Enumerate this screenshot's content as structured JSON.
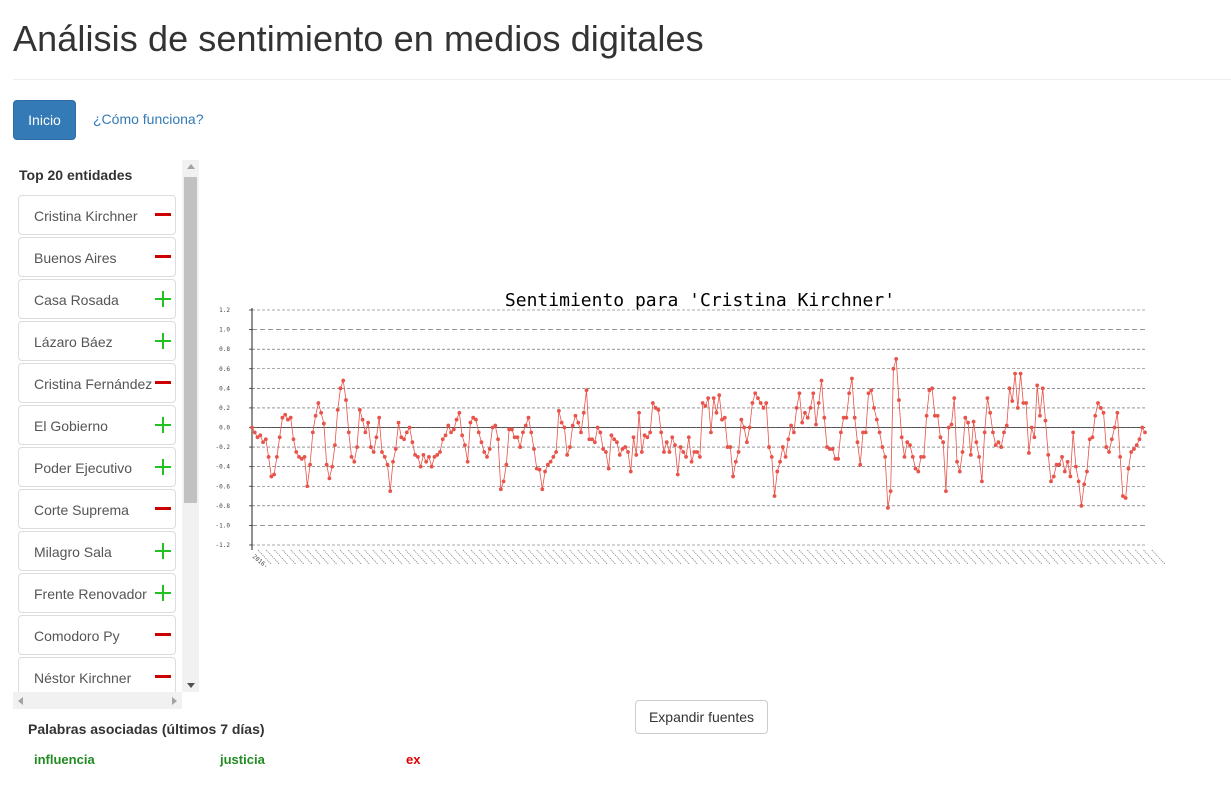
{
  "page": {
    "title": "Análisis de sentimiento en medios digitales"
  },
  "nav": {
    "home_label": "Inicio",
    "how_label": "¿Cómo funciona?"
  },
  "entities_panel": {
    "title": "Top 20 entidades",
    "items": [
      {
        "label": "Cristina Kirchner",
        "sign": "minus"
      },
      {
        "label": "Buenos Aires",
        "sign": "minus"
      },
      {
        "label": "Casa Rosada",
        "sign": "plus"
      },
      {
        "label": "Lázaro Báez",
        "sign": "plus"
      },
      {
        "label": "Cristina Fernández",
        "sign": "minus"
      },
      {
        "label": "El Gobierno",
        "sign": "plus"
      },
      {
        "label": "Poder Ejecutivo",
        "sign": "plus"
      },
      {
        "label": "Corte Suprema",
        "sign": "minus"
      },
      {
        "label": "Milagro Sala",
        "sign": "plus"
      },
      {
        "label": "Frente Renovador",
        "sign": "plus"
      },
      {
        "label": "Comodoro Py",
        "sign": "minus"
      },
      {
        "label": "Néstor Kirchner",
        "sign": "minus"
      }
    ]
  },
  "words": {
    "title": "Palabras asociadas (últimos 7 días)",
    "items": [
      {
        "text": "influencia",
        "color": "#228b22"
      },
      {
        "text": "justicia",
        "color": "#228b22"
      },
      {
        "text": "ex",
        "color": "#dd0000"
      }
    ]
  },
  "expand_button": "Expandir fuentes",
  "colors": {
    "primary": "#337ab7",
    "line": "#e8534a",
    "positive": "#22c222",
    "negative": "#cc0000"
  },
  "chart_data": {
    "type": "line",
    "title": "Sentimiento para 'Cristina Kirchner'",
    "ylim": [
      -1.2,
      1.2
    ],
    "yticks": [
      -1.2,
      -1.0,
      -0.8,
      -0.6,
      -0.4,
      -0.2,
      0.0,
      0.2,
      0.4,
      0.6,
      0.8,
      1.0,
      1.2
    ],
    "ytick_labels": [
      "-1.2",
      "-1.0",
      "-0.8",
      "-0.6",
      "-0.4",
      "-0.2",
      "0.0",
      "0.2",
      "0.4",
      "0.6",
      "0.8",
      "1.0",
      "1.2"
    ],
    "grid": true,
    "first_x_label": "2016-",
    "values": [
      0.0,
      -0.05,
      -0.1,
      -0.08,
      -0.15,
      -0.12,
      -0.3,
      -0.5,
      -0.48,
      -0.3,
      -0.1,
      0.1,
      0.13,
      0.08,
      0.1,
      -0.12,
      -0.25,
      -0.3,
      -0.32,
      -0.3,
      -0.6,
      -0.38,
      -0.05,
      0.12,
      0.25,
      0.15,
      0.04,
      -0.38,
      -0.52,
      -0.4,
      -0.18,
      0.18,
      0.4,
      0.48,
      0.28,
      -0.05,
      -0.3,
      -0.35,
      -0.2,
      0.18,
      0.08,
      -0.05,
      0.05,
      -0.2,
      -0.25,
      -0.1,
      0.1,
      -0.25,
      -0.3,
      -0.38,
      -0.65,
      -0.35,
      -0.22,
      0.05,
      -0.1,
      -0.12,
      -0.05,
      0.0,
      -0.15,
      -0.28,
      -0.3,
      -0.4,
      -0.28,
      -0.35,
      -0.3,
      -0.4,
      -0.3,
      -0.28,
      -0.25,
      -0.12,
      -0.08,
      0.02,
      -0.05,
      -0.02,
      0.08,
      0.15,
      -0.08,
      -0.18,
      -0.35,
      0.05,
      0.1,
      0.08,
      -0.05,
      -0.15,
      -0.25,
      -0.3,
      -0.22,
      0.0,
      0.02,
      -0.12,
      -0.63,
      -0.55,
      -0.38,
      -0.02,
      -0.02,
      -0.1,
      -0.1,
      -0.2,
      -0.05,
      0.02,
      0.1,
      -0.05,
      -0.22,
      -0.42,
      -0.43,
      -0.63,
      -0.45,
      -0.38,
      -0.35,
      -0.3,
      -0.25,
      0.17,
      0.05,
      0.0,
      -0.28,
      -0.2,
      0.02,
      0.12,
      0.05,
      -0.05,
      0.15,
      0.38,
      -0.12,
      -0.12,
      -0.15,
      0.0,
      -0.05,
      -0.22,
      -0.25,
      -0.42,
      -0.08,
      -0.12,
      -0.15,
      -0.28,
      -0.22,
      -0.2,
      -0.25,
      -0.45,
      -0.1,
      -0.28,
      0.15,
      -0.25,
      -0.08,
      -0.1,
      -0.05,
      0.25,
      0.2,
      0.18,
      -0.05,
      -0.25,
      -0.15,
      -0.25,
      -0.1,
      -0.18,
      -0.48,
      -0.2,
      -0.25,
      -0.3,
      -0.1,
      -0.35,
      -0.25,
      -0.25,
      -0.3,
      0.25,
      0.22,
      0.3,
      -0.05,
      0.3,
      0.15,
      0.33,
      0.08,
      0.1,
      -0.2,
      -0.2,
      -0.5,
      -0.35,
      -0.25,
      0.08,
      0.0,
      -0.15,
      0.0,
      0.25,
      0.35,
      0.3,
      0.25,
      0.2,
      0.25,
      -0.2,
      -0.3,
      -0.7,
      -0.45,
      -0.35,
      -0.2,
      -0.3,
      -0.12,
      0.02,
      -0.05,
      0.2,
      0.35,
      0.05,
      0.15,
      0.1,
      0.2,
      0.35,
      0.03,
      0.25,
      0.48,
      0.1,
      -0.2,
      -0.22,
      -0.22,
      -0.32,
      -0.32,
      -0.05,
      0.1,
      0.1,
      0.35,
      0.5,
      0.1,
      -0.15,
      -0.38,
      -0.05,
      -0.05,
      0.35,
      0.38,
      0.2,
      0.08,
      -0.05,
      -0.2,
      -0.3,
      -0.82,
      -0.65,
      0.6,
      0.7,
      0.28,
      -0.1,
      -0.3,
      -0.15,
      -0.18,
      -0.3,
      -0.42,
      -0.45,
      -0.3,
      -0.3,
      0.12,
      0.38,
      0.4,
      0.12,
      0.12,
      -0.1,
      -0.15,
      -0.65,
      0.0,
      0.03,
      0.3,
      -0.35,
      -0.45,
      -0.25,
      0.1,
      0.05,
      -0.28,
      0.06,
      -0.15,
      -0.3,
      -0.55,
      -0.05,
      0.3,
      0.15,
      -0.05,
      -0.18,
      -0.15,
      -0.2,
      -0.05,
      0.02,
      0.4,
      0.27,
      0.55,
      0.2,
      0.55,
      0.25,
      0.25,
      -0.26,
      0.0,
      -0.1,
      0.43,
      0.12,
      0.4,
      0.07,
      -0.28,
      -0.55,
      -0.5,
      -0.38,
      -0.38,
      -0.3,
      -0.45,
      -0.35,
      -0.5,
      -0.05,
      -0.4,
      -0.55,
      -0.8,
      -0.58,
      -0.45,
      -0.12,
      -0.1,
      0.12,
      0.25,
      0.2,
      0.15,
      -0.2,
      -0.25,
      -0.12,
      0.0,
      0.15,
      -0.3,
      -0.7,
      -0.72,
      -0.42,
      -0.25,
      -0.22,
      -0.18,
      -0.12,
      0.0,
      -0.05
    ]
  }
}
